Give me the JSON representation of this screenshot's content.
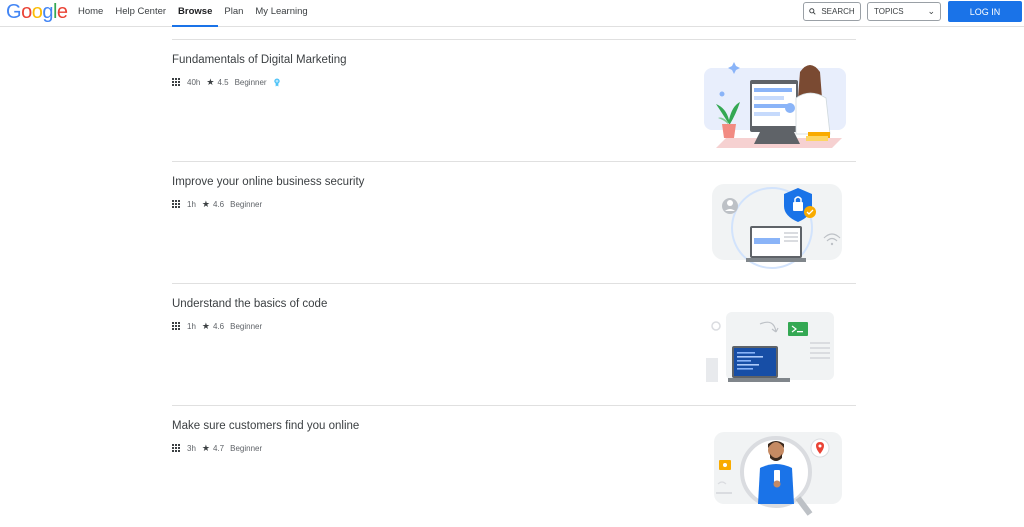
{
  "header": {
    "logo": "Google",
    "nav": [
      "Home",
      "Help Center",
      "Browse",
      "Plan",
      "My Learning"
    ],
    "active_nav": "Browse",
    "search_label": "SEARCH",
    "topics_label": "TOPICS",
    "login_label": "LOG IN"
  },
  "colors": {
    "accent": "#1a73e8"
  },
  "courses": [
    {
      "title": "Fundamentals of Digital Marketing",
      "duration": "40h",
      "rating": "4.5",
      "level": "Beginner",
      "has_badge": true
    },
    {
      "title": "Improve your online business security",
      "duration": "1h",
      "rating": "4.6",
      "level": "Beginner"
    },
    {
      "title": "Understand the basics of code",
      "duration": "1h",
      "rating": "4.6",
      "level": "Beginner"
    },
    {
      "title": "Make sure customers find you online",
      "duration": "3h",
      "rating": "4.7",
      "level": "Beginner"
    }
  ]
}
